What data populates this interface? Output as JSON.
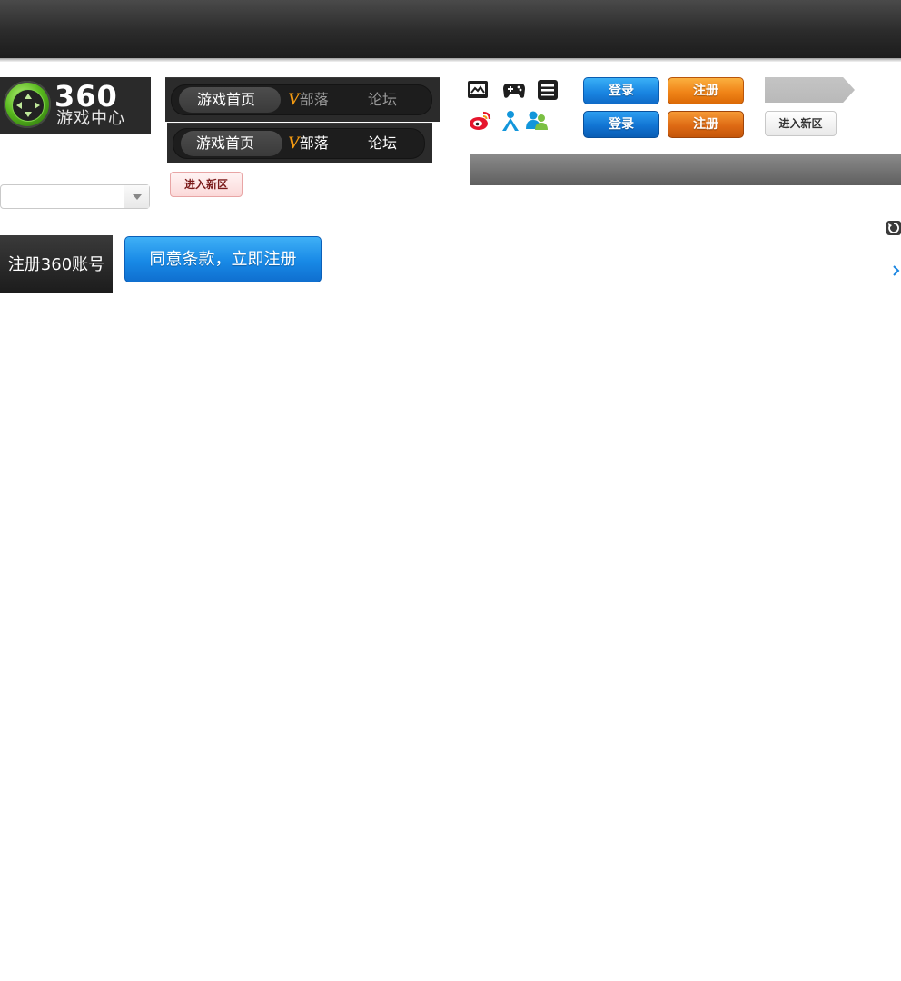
{
  "logo": {
    "number": "360",
    "subtitle": "游戏中心"
  },
  "nav_primary": {
    "items": [
      {
        "label": "游戏首页"
      },
      {
        "v_mark": "V",
        "label": "部落"
      },
      {
        "label": "论坛"
      }
    ]
  },
  "nav_secondary": {
    "items": [
      {
        "label": "游戏首页"
      },
      {
        "v_mark": "V",
        "label": "部落"
      },
      {
        "label": "论坛"
      }
    ]
  },
  "buttons": {
    "enter_new_red": "进入新区",
    "enter_new_grey": "进入新区",
    "login_1": "登录",
    "register_1": "注册",
    "login_2": "登录",
    "register_2": "注册",
    "agree_register": "同意条款，立即注册"
  },
  "register_title": "注册360账号",
  "icons": {
    "row1": [
      "picture-icon",
      "gamepad-icon",
      "list-icon"
    ],
    "row2": [
      "weibo-icon",
      "qq-icon",
      "user-group-icon"
    ],
    "misc": [
      "refresh-icon",
      "chevron-right-icon",
      "dropdown-arrow-icon"
    ]
  },
  "colors": {
    "topbar": "#2b2b2b",
    "brand_green": "#58b81e",
    "v_orange": "#f39a12",
    "blue_button": "#1a86e2",
    "orange_button": "#f08418",
    "weibo_red": "#e6162d",
    "qq_blue": "#1296db"
  }
}
